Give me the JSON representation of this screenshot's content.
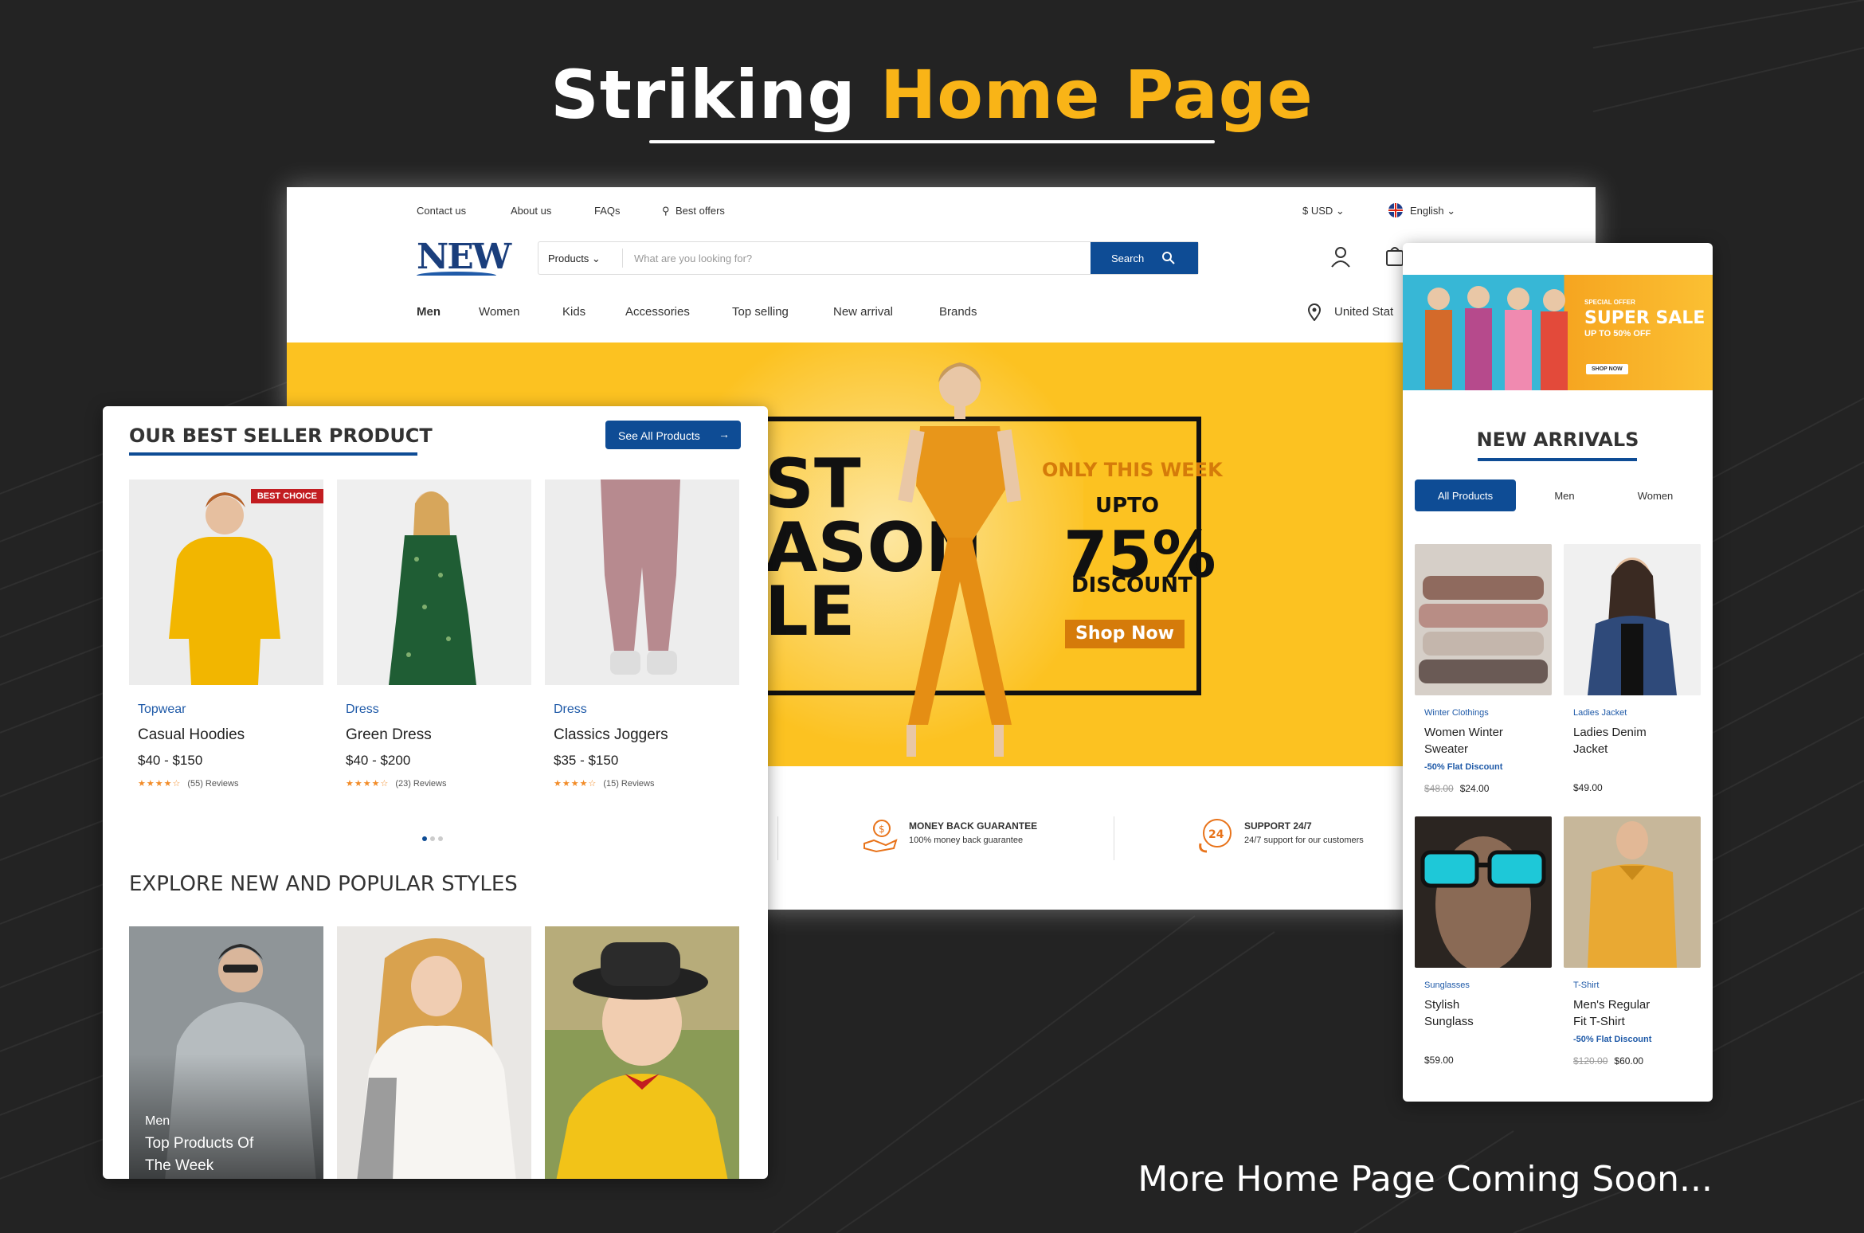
{
  "showcase": {
    "title_part1": "Striking",
    "title_part2": "Home Page",
    "footer": "More Home Page Coming Soon..."
  },
  "desktop": {
    "topbar": {
      "contact": "Contact us",
      "about": "About us",
      "faqs": "FAQs",
      "offers": "Best offers",
      "currency": "$ USD",
      "language": "English"
    },
    "logo": "NEW",
    "search": {
      "category": "Products",
      "placeholder": "What are you looking for?",
      "button": "Search"
    },
    "nav": [
      "Men",
      "Women",
      "Kids",
      "Accessories",
      "Top selling",
      "New arrival",
      "Brands"
    ],
    "location": "United Stat",
    "hero": {
      "line1": "ST",
      "line2": "ASON",
      "line3": "LE",
      "only_week": "ONLY THIS WEEK",
      "upto": "UPTO",
      "percent": "75%",
      "discount": "DISCOUNT",
      "cta": "Shop Now"
    },
    "features": [
      {
        "title": "MONEY BACK GUARANTEE",
        "sub": "100% money back guarantee"
      },
      {
        "title": "SUPPORT 24/7",
        "sub": "24/7 support for our customers"
      }
    ]
  },
  "bestseller": {
    "title": "OUR BEST SELLER PRODUCT",
    "see_all": "See All Products",
    "products": [
      {
        "category": "Topwear",
        "name": "Casual Hoodies",
        "price": "$40 - $150",
        "reviews": "(55) Reviews",
        "badge": "BEST CHOICE"
      },
      {
        "category": "Dress",
        "name": "Green Dress",
        "price": "$40 - $200",
        "reviews": "(23) Reviews"
      },
      {
        "category": "Dress",
        "name": "Classics Joggers",
        "price": "$35 - $150",
        "reviews": "(15) Reviews"
      }
    ],
    "explore_title": "EXPLORE NEW AND POPULAR STYLES",
    "explore_card": {
      "tag": "Men",
      "title1": "Top Products Of",
      "title2": "The Week"
    }
  },
  "arrivals": {
    "banner": {
      "special": "SPECIAL OFFER",
      "super": "SUPER SALE",
      "upto": "UP TO 50% OFF",
      "button": "SHOP NOW"
    },
    "title": "NEW ARRIVALS",
    "tabs": [
      "All Products",
      "Men",
      "Women"
    ],
    "products": [
      {
        "category": "Winter Clothings",
        "name1": "Women Winter",
        "name2": "Sweater",
        "discount": "-50% Flat Discount",
        "old_price": "$48.00",
        "price": "$24.00"
      },
      {
        "category": "Ladies Jacket",
        "name1": "Ladies Denim",
        "name2": "Jacket",
        "price": "$49.00"
      },
      {
        "category": "Sunglasses",
        "name1": "Stylish",
        "name2": "Sunglass",
        "price": "$59.00"
      },
      {
        "category": "T-Shirt",
        "name1": "Men's Regular",
        "name2": "Fit T-Shirt",
        "discount": "-50% Flat Discount",
        "old_price": "$120.00",
        "price": "$60.00"
      }
    ]
  },
  "colors": {
    "brand_blue": "#0e4c95",
    "accent_yellow": "#f9b417",
    "hero_yellow": "#fcc221",
    "bg": "#232323"
  }
}
